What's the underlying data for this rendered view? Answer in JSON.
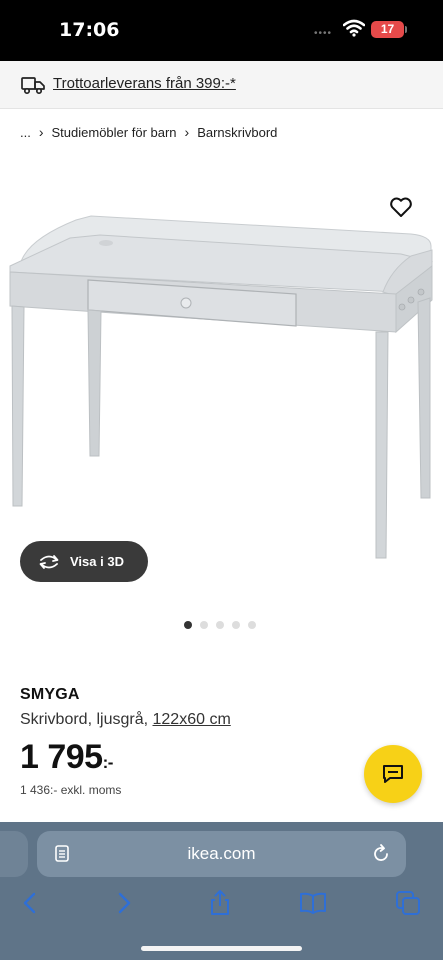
{
  "status_bar": {
    "time": "17:06",
    "battery": "17"
  },
  "delivery_banner": {
    "text": "Trottoarleverans från 399:-*"
  },
  "breadcrumb": {
    "ellipsis": "...",
    "items": [
      "Studiemöbler för barn",
      "Barnskrivbord"
    ]
  },
  "gallery": {
    "view_3d_label": "Visa i 3D",
    "dot_count": 5,
    "active_dot": 0
  },
  "product": {
    "name": "SMYGA",
    "description": "Skrivbord, ljusgrå,",
    "dimensions": "122x60 cm",
    "price": "1 795",
    "price_suffix": ":-",
    "price_ex_vat": "1 436:- exkl. moms"
  },
  "browser": {
    "url": "ikea.com"
  },
  "colors": {
    "accent_chat": "#f7d117",
    "browser_bar": "#5f7488",
    "toolbar_icons": "#2f6fd6"
  }
}
